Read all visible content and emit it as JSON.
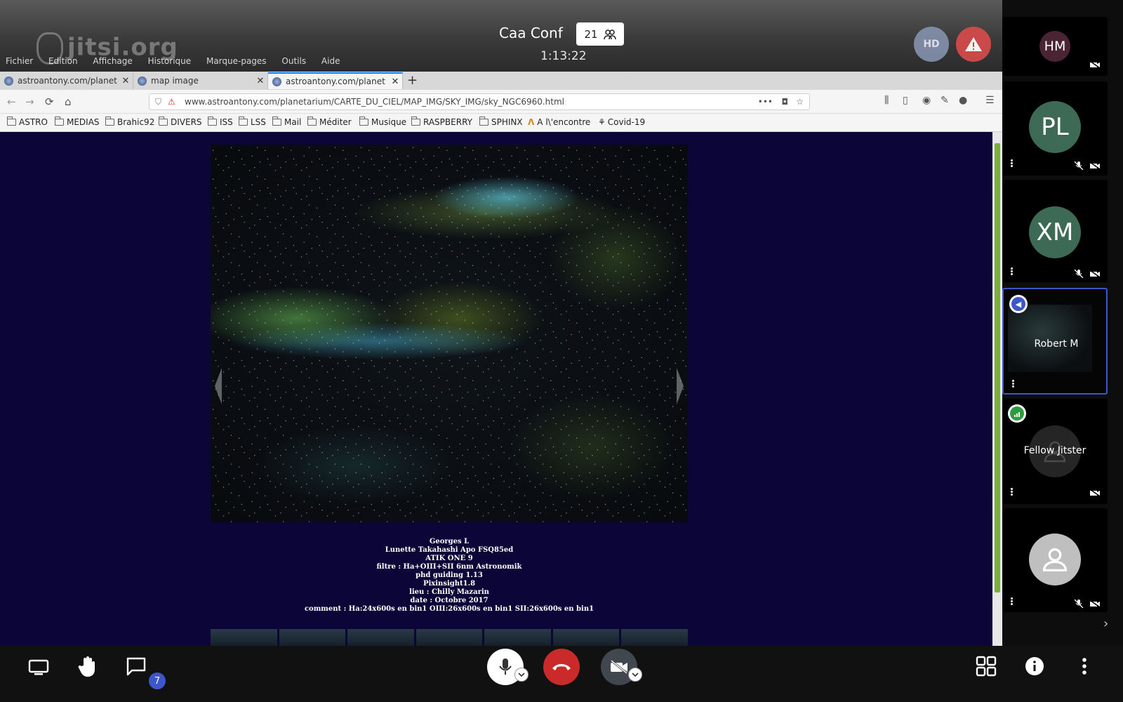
{
  "conference": {
    "title": "Caa Conf",
    "participant_count": "21",
    "duration": "1:13:22",
    "logo": "jitsi.org"
  },
  "indicators": {
    "hd_label": "HD",
    "warning_icon": "warning-icon"
  },
  "browser": {
    "menus": [
      "Fichier",
      "Edition",
      "Affichage",
      "Historique",
      "Marque-pages",
      "Outils",
      "Aide"
    ],
    "tabs": [
      {
        "label": "astroantony.com/planet",
        "active": false
      },
      {
        "label": "map image",
        "active": false
      },
      {
        "label": "astroantony.com/planet",
        "active": true
      }
    ],
    "url": "www.astroantony.com/planetarium/CARTE_DU_CIEL/MAP_IMG/SKY_IMG/sky_NGC6960.html",
    "bookmarks": [
      "ASTRO",
      "MEDIAS",
      "Brahic92",
      "DIVERS",
      "ISS",
      "LSS",
      "Mail",
      "Méditer",
      "Musique",
      "RASPBERRY",
      "SPHINX",
      "A l\\'encontre",
      "Covid-19"
    ]
  },
  "page": {
    "caption": [
      "Georges L",
      "Lunette Takahashi Apo FSQ85ed",
      "ATIK ONE 9",
      "filtre : Ha+OIII+SII 6nm Astronomik",
      "phd guiding 1.13",
      "Pixinsight1.8",
      "lieu : Chilly Mazarin",
      "date : Octobre 2017",
      "comment : Ha:24x600s en bin1 OIII:26x600s en bin1 SII:26x600s en bin1"
    ]
  },
  "participants": [
    {
      "initials": "HM",
      "name": "",
      "color": "#4a2432"
    },
    {
      "initials": "PL",
      "name": "",
      "color": "#3d6a55"
    },
    {
      "initials": "XM",
      "name": "",
      "color": "#3d6a55"
    },
    {
      "initials": "",
      "name": "Robert M",
      "color": ""
    },
    {
      "initials": "",
      "name": "Fellow Jitster",
      "color": "#555"
    },
    {
      "initials": "",
      "name": "",
      "color": "#bfbfbf"
    }
  ],
  "toolbar": {
    "chat_unread": "7"
  },
  "colors": {
    "accent": "#3d56c8",
    "hangup": "#cb2a2a",
    "page_bg": "#0b0637",
    "progress_green": "#7cae3a"
  }
}
